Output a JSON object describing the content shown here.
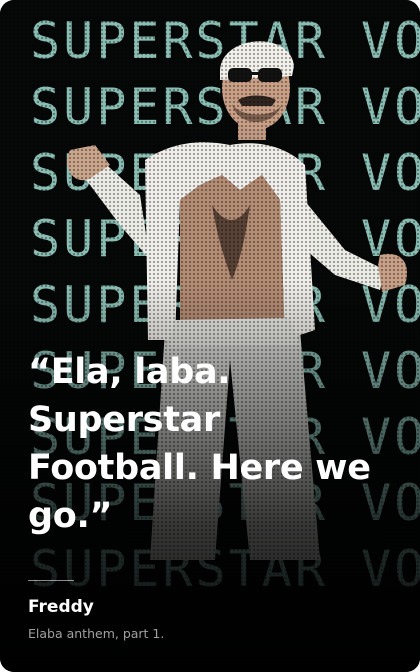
{
  "quote": {
    "text": "“Ela, laba. Superstar Football. Here we go.”",
    "author": "Freddy",
    "source": "Elaba anthem, part 1."
  },
  "background": {
    "backdrop_text": [
      "SUPERSTAR VOETBAL",
      "SUPERSTAR VOETBAL",
      "SUPERSTAR VOETBAL",
      "SUPERSTAR VOETBAL",
      "SUPERSTAR VOETBAL",
      "SUPERSTAR VOETBAL",
      "SUPERSTAR VOETBAL",
      "SUPERSTAR VOETBAL",
      "SUPERSTAR VOETBAL"
    ],
    "text_color": "#a8e6da",
    "base_color": "#050807"
  }
}
